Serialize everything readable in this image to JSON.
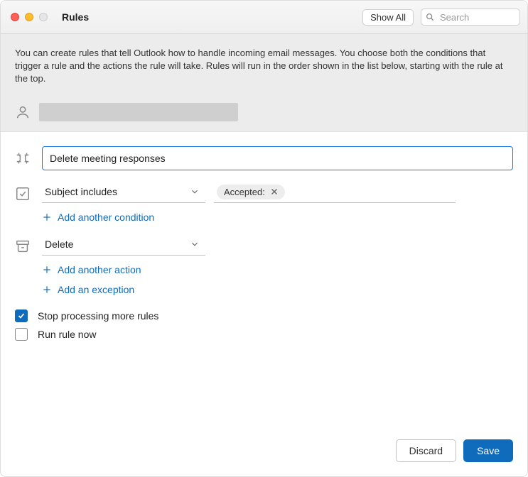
{
  "window": {
    "title": "Rules"
  },
  "toolbar": {
    "show_all": "Show All",
    "search_placeholder": "Search"
  },
  "header": {
    "description": "You can create rules that tell Outlook how to handle incoming email messages. You choose both the conditions that trigger a rule and the actions the rule will take. Rules will run in the order shown in the list below, starting with the rule at the top."
  },
  "rule": {
    "name": "Delete meeting responses",
    "condition": {
      "field": "Subject includes",
      "tag": "Accepted:"
    },
    "add_condition": "Add another condition",
    "action": {
      "field": "Delete"
    },
    "add_action": "Add another action",
    "add_exception": "Add an exception"
  },
  "options": {
    "stop_processing": {
      "label": "Stop processing more rules",
      "checked": true
    },
    "run_now": {
      "label": "Run rule now",
      "checked": false
    }
  },
  "footer": {
    "discard": "Discard",
    "save": "Save"
  }
}
